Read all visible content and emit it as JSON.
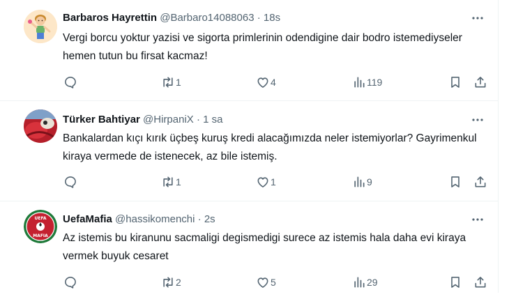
{
  "tweets": [
    {
      "name": "Barbaros Hayrettin",
      "handle": "@Barbaro14088063",
      "separator": "·",
      "time": "18s",
      "text": "Vergi borcu yoktur yazisi ve sigorta primlerinin odendigine dair bodro istemediyseler hemen tutun bu firsat kacmaz!",
      "replies": "",
      "retweets": "1",
      "likes": "4",
      "views": "119"
    },
    {
      "name": "Türker Bahtiyar",
      "handle": "@HirpaniX",
      "separator": "·",
      "time": "1 sa",
      "text": "Bankalardan kıçı kırık üçbeş kuruş kredi alacağımızda neler istemiyorlar? Gayrimenkul kiraya vermede de istenecek, az bile istemiş.",
      "replies": "",
      "retweets": "1",
      "likes": "1",
      "views": "9"
    },
    {
      "name": "UefaMafia",
      "handle": "@hassikomenchi",
      "separator": "·",
      "time": "2s",
      "text": "Az istemis bu kiranunu sacmaligi degismedigi surece az istemis hala daha evi kiraya vermek buyuk cesaret",
      "replies": "",
      "retweets": "2",
      "likes": "5",
      "views": "29",
      "avatar_text_top": "UEFA",
      "avatar_text_bottom": "MAFIA"
    }
  ],
  "icons": {
    "reply": "reply-icon",
    "retweet": "retweet-icon",
    "like": "heart-icon",
    "views": "views-chart-icon",
    "bookmark": "bookmark-icon",
    "share": "share-icon",
    "more": "more-dots-icon"
  },
  "colors": {
    "text": "#0f1419",
    "secondary": "#536471",
    "divider": "#eff3f4"
  }
}
